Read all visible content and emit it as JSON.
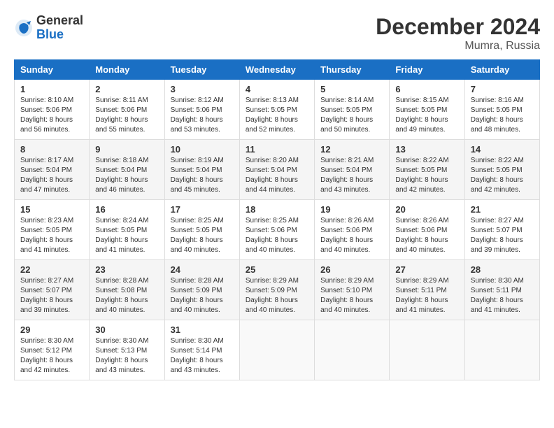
{
  "header": {
    "logo_general": "General",
    "logo_blue": "Blue",
    "month_year": "December 2024",
    "location": "Mumra, Russia"
  },
  "weekdays": [
    "Sunday",
    "Monday",
    "Tuesday",
    "Wednesday",
    "Thursday",
    "Friday",
    "Saturday"
  ],
  "weeks": [
    [
      {
        "day": "1",
        "sunrise": "8:10 AM",
        "sunset": "5:06 PM",
        "daylight": "8 hours and 56 minutes."
      },
      {
        "day": "2",
        "sunrise": "8:11 AM",
        "sunset": "5:06 PM",
        "daylight": "8 hours and 55 minutes."
      },
      {
        "day": "3",
        "sunrise": "8:12 AM",
        "sunset": "5:06 PM",
        "daylight": "8 hours and 53 minutes."
      },
      {
        "day": "4",
        "sunrise": "8:13 AM",
        "sunset": "5:05 PM",
        "daylight": "8 hours and 52 minutes."
      },
      {
        "day": "5",
        "sunrise": "8:14 AM",
        "sunset": "5:05 PM",
        "daylight": "8 hours and 50 minutes."
      },
      {
        "day": "6",
        "sunrise": "8:15 AM",
        "sunset": "5:05 PM",
        "daylight": "8 hours and 49 minutes."
      },
      {
        "day": "7",
        "sunrise": "8:16 AM",
        "sunset": "5:05 PM",
        "daylight": "8 hours and 48 minutes."
      }
    ],
    [
      {
        "day": "8",
        "sunrise": "8:17 AM",
        "sunset": "5:04 PM",
        "daylight": "8 hours and 47 minutes."
      },
      {
        "day": "9",
        "sunrise": "8:18 AM",
        "sunset": "5:04 PM",
        "daylight": "8 hours and 46 minutes."
      },
      {
        "day": "10",
        "sunrise": "8:19 AM",
        "sunset": "5:04 PM",
        "daylight": "8 hours and 45 minutes."
      },
      {
        "day": "11",
        "sunrise": "8:20 AM",
        "sunset": "5:04 PM",
        "daylight": "8 hours and 44 minutes."
      },
      {
        "day": "12",
        "sunrise": "8:21 AM",
        "sunset": "5:04 PM",
        "daylight": "8 hours and 43 minutes."
      },
      {
        "day": "13",
        "sunrise": "8:22 AM",
        "sunset": "5:05 PM",
        "daylight": "8 hours and 42 minutes."
      },
      {
        "day": "14",
        "sunrise": "8:22 AM",
        "sunset": "5:05 PM",
        "daylight": "8 hours and 42 minutes."
      }
    ],
    [
      {
        "day": "15",
        "sunrise": "8:23 AM",
        "sunset": "5:05 PM",
        "daylight": "8 hours and 41 minutes."
      },
      {
        "day": "16",
        "sunrise": "8:24 AM",
        "sunset": "5:05 PM",
        "daylight": "8 hours and 41 minutes."
      },
      {
        "day": "17",
        "sunrise": "8:25 AM",
        "sunset": "5:05 PM",
        "daylight": "8 hours and 40 minutes."
      },
      {
        "day": "18",
        "sunrise": "8:25 AM",
        "sunset": "5:06 PM",
        "daylight": "8 hours and 40 minutes."
      },
      {
        "day": "19",
        "sunrise": "8:26 AM",
        "sunset": "5:06 PM",
        "daylight": "8 hours and 40 minutes."
      },
      {
        "day": "20",
        "sunrise": "8:26 AM",
        "sunset": "5:06 PM",
        "daylight": "8 hours and 40 minutes."
      },
      {
        "day": "21",
        "sunrise": "8:27 AM",
        "sunset": "5:07 PM",
        "daylight": "8 hours and 39 minutes."
      }
    ],
    [
      {
        "day": "22",
        "sunrise": "8:27 AM",
        "sunset": "5:07 PM",
        "daylight": "8 hours and 39 minutes."
      },
      {
        "day": "23",
        "sunrise": "8:28 AM",
        "sunset": "5:08 PM",
        "daylight": "8 hours and 40 minutes."
      },
      {
        "day": "24",
        "sunrise": "8:28 AM",
        "sunset": "5:09 PM",
        "daylight": "8 hours and 40 minutes."
      },
      {
        "day": "25",
        "sunrise": "8:29 AM",
        "sunset": "5:09 PM",
        "daylight": "8 hours and 40 minutes."
      },
      {
        "day": "26",
        "sunrise": "8:29 AM",
        "sunset": "5:10 PM",
        "daylight": "8 hours and 40 minutes."
      },
      {
        "day": "27",
        "sunrise": "8:29 AM",
        "sunset": "5:11 PM",
        "daylight": "8 hours and 41 minutes."
      },
      {
        "day": "28",
        "sunrise": "8:30 AM",
        "sunset": "5:11 PM",
        "daylight": "8 hours and 41 minutes."
      }
    ],
    [
      {
        "day": "29",
        "sunrise": "8:30 AM",
        "sunset": "5:12 PM",
        "daylight": "8 hours and 42 minutes."
      },
      {
        "day": "30",
        "sunrise": "8:30 AM",
        "sunset": "5:13 PM",
        "daylight": "8 hours and 43 minutes."
      },
      {
        "day": "31",
        "sunrise": "8:30 AM",
        "sunset": "5:14 PM",
        "daylight": "8 hours and 43 minutes."
      },
      null,
      null,
      null,
      null
    ]
  ],
  "labels": {
    "sunrise": "Sunrise:",
    "sunset": "Sunset:",
    "daylight": "Daylight hours"
  }
}
